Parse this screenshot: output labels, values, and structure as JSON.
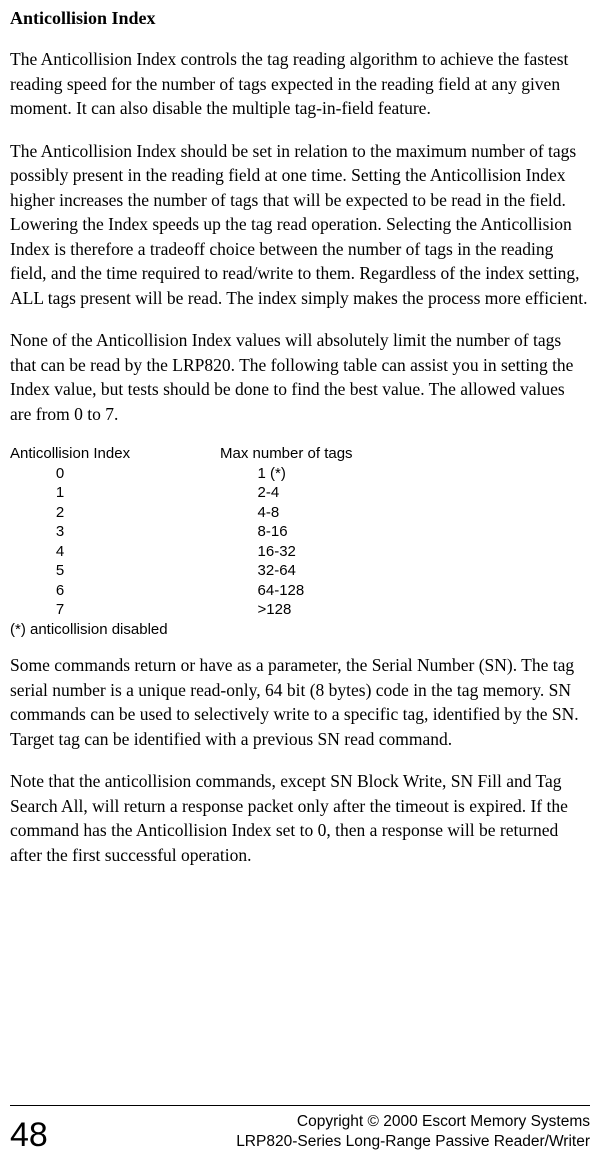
{
  "title": "Anticollision Index",
  "para1": "The Anticollision Index controls the tag reading algorithm to achieve the fastest reading speed for the number of tags expected in the reading field at any given moment. It can also disable the multiple tag-in-field feature.",
  "para2": "The Anticollision Index should be set in relation to the maximum number of tags possibly present in the reading field at one time.  Setting the Anticollision Index higher increases the number of tags that will be expected to be read in the field.  Lowering the Index speeds up the tag read operation. Selecting the Anticollision Index is therefore a tradeoff choice between the number of tags in the reading field, and the time required to read/write to them. Regardless of the index setting, ALL tags present will be read. The index simply makes the process more efficient.",
  "para3": "None of the Anticollision Index values will absolutely limit the number of tags that can be read by the LRP820.  The following table can assist you in setting the Index value, but tests should be done to find the best value.  The allowed values are from 0 to 7.",
  "table": {
    "header_idx": "Anticollision Index",
    "header_tags": "Max number of tags",
    "rows": [
      {
        "idx": "0",
        "tags": "1 (*)"
      },
      {
        "idx": "1",
        "tags": "2-4"
      },
      {
        "idx": "2",
        "tags": "4-8"
      },
      {
        "idx": "3",
        "tags": "8-16"
      },
      {
        "idx": "4",
        "tags": "16-32"
      },
      {
        "idx": "5",
        "tags": "32-64"
      },
      {
        "idx": "6",
        "tags": "64-128"
      },
      {
        "idx": "7",
        "tags": ">128"
      }
    ],
    "footnote": "(*) anticollision disabled"
  },
  "para4": "Some commands return or have as a parameter, the Serial Number (SN). The tag serial number is a unique read-only, 64 bit (8 bytes) code in the tag memory. SN commands  can be used to selectively write to a specific tag, identified by the SN. Target tag can be identified with a previous SN read command.",
  "para5": "Note that the anticollision commands, except SN Block Write, SN Fill and Tag Search All, will return a response packet only after the timeout is expired.  If the command has the Anticollision Index set to 0, then a response will be returned after the first successful operation.",
  "footer": {
    "page": "48",
    "copyright": "Copyright © 2000 Escort Memory Systems",
    "product": "LRP820-Series Long-Range Passive Reader/Writer"
  }
}
